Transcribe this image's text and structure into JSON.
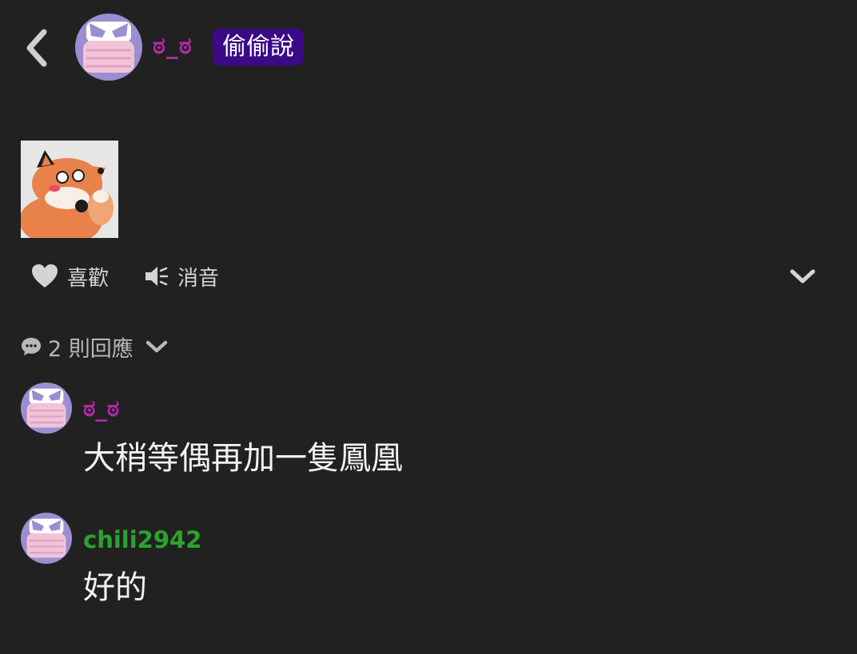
{
  "header": {
    "author_name": "ಠ_ಠ",
    "badge": "偷偷說"
  },
  "actions": {
    "like_label": "喜歡",
    "mute_label": "消音"
  },
  "replies": {
    "count_label": "2 則回應"
  },
  "comments": [
    {
      "author": "ಠ_ಠ",
      "author_color": "#b02aa8",
      "text": "大稍等偶再加一隻鳳凰"
    },
    {
      "author": "chili2942",
      "author_color": "#2aa52a",
      "text": "好的"
    }
  ],
  "colors": {
    "background": "#212121",
    "badge_bg": "#3b0a86",
    "avatar_bg": "#9b8ed0",
    "mask_color": "#f2c3d8"
  }
}
